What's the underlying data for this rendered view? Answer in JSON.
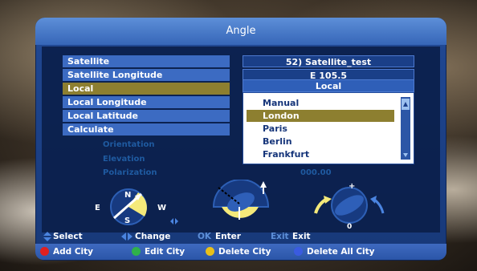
{
  "window": {
    "title": "Angle"
  },
  "rows": [
    {
      "label": "Satellite",
      "value": "52) Satellite_test"
    },
    {
      "label": "Satellite Longitude",
      "value": "E 105.5"
    },
    {
      "label": "Local",
      "value": "Local"
    },
    {
      "label": "Local Longitude"
    },
    {
      "label": "Local Latitude"
    },
    {
      "label": "Calculate"
    }
  ],
  "results": {
    "orientation_label": "Orientation",
    "elevation_label": "Elevation",
    "polarization_label": "Polarization",
    "polarization_value": "000.00"
  },
  "dropdown": {
    "items": [
      "Manual",
      "London",
      "Paris",
      "Berlin",
      "Frankfurt"
    ],
    "selected": "London"
  },
  "compass": {
    "e": "E",
    "w": "W",
    "n": "N",
    "s": "S"
  },
  "polar_dial": {
    "zero": "0"
  },
  "help": {
    "select": "Select",
    "change": "Change",
    "ok_key": "OK",
    "enter": "Enter",
    "exit_key": "Exit",
    "exit": "Exit"
  },
  "color_keys": [
    {
      "label": "Add City",
      "color": "#e02020"
    },
    {
      "label": "Edit City",
      "color": "#2fb14a"
    },
    {
      "label": "Delete City",
      "color": "#e8c01a"
    },
    {
      "label": "Delete All City",
      "color": "#3a5be0"
    }
  ]
}
